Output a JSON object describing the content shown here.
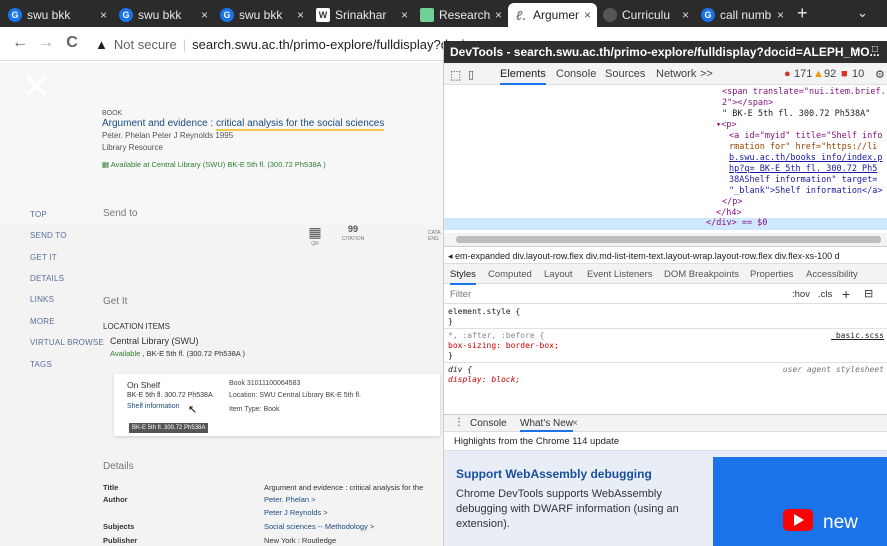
{
  "browser": {
    "tabs": [
      {
        "title": "swu bkk",
        "icon": "chrome-icon",
        "close": "×"
      },
      {
        "title": "swu bkk",
        "icon": "chrome-icon",
        "close": "×"
      },
      {
        "title": "swu bkk",
        "icon": "chrome-icon",
        "close": "×"
      },
      {
        "title": "Srinakhar",
        "icon": "wikipedia-icon",
        "close": "×"
      },
      {
        "title": "Research",
        "icon": "research-icon",
        "close": "×"
      },
      {
        "title": "Argumen",
        "icon": "document-icon",
        "close": "×"
      },
      {
        "title": "Curriculu",
        "icon": "loading-icon",
        "close": "×"
      },
      {
        "title": "call numb",
        "icon": "chrome-icon",
        "close": "×"
      }
    ],
    "new_tab": "+",
    "tab_menu": "⌄",
    "back": "←",
    "forward": "→",
    "reload": "C",
    "security": "Not secure",
    "url": "search.swu.ac.th/primo-explore/fulldisplay?docid=ALEPH"
  },
  "page": {
    "item_type": "BOOK",
    "title_main": "Argument and evidence : ",
    "title_highlight": "critical analysis for the social sciences",
    "authors": "Peter. Phelan Peter J Reynolds 1995",
    "resource": "Library Resource",
    "availability": "Available at Central Library (SWU)  BK-E 5th fl. (300.72 Ph538A )",
    "nav": [
      "TOP",
      "SEND TO",
      "GET IT",
      "DETAILS",
      "LINKS",
      "MORE",
      "VIRTUAL BROWSE",
      "TAGS"
    ],
    "send_to_heading": "Send to",
    "send_options": [
      {
        "icon": "qr-icon",
        "glyph": "▦",
        "label": "QR"
      },
      {
        "icon": "citation-icon",
        "glyph": "99",
        "label": "CITATION"
      },
      {
        "icon": "catalog-icon",
        "glyph": "",
        "label": "CATA ENG"
      }
    ],
    "get_it_heading": "Get It",
    "location_items": "LOCATION ITEMS",
    "library": "Central Library (SWU)",
    "library_status": "Available",
    "library_shelf": " , BK-E 5th fl. (300.72 Ph538A )",
    "card": {
      "status": "On Shelf",
      "call_no": "BK-E 5th fl. 300.72 Ph538A",
      "shelf_link": "Shelf information",
      "barcode": "Book 31011100064583",
      "location": "Location: SWU Central Library BK-E 5th fl.",
      "item_type": "Item Type: Book",
      "tooltip": "BK-E 5th fl. 300.72 Ph538A"
    },
    "details_heading": "Details",
    "details": [
      {
        "label": "Title",
        "values": [
          "Argument and evidence : critical analysis for the"
        ]
      },
      {
        "label": "Author",
        "values": [
          "Peter. Phelan >",
          "Peter J Reynolds >"
        ]
      },
      {
        "label": "Subjects",
        "values": [
          "Social sciences -- Methodology >"
        ]
      },
      {
        "label": "Publisher",
        "values": [
          "New York : Routledge"
        ]
      }
    ]
  },
  "devtools": {
    "title": "DevTools - search.swu.ac.th/primo-explore/fulldisplay?docid=ALEPH_MO...",
    "window_controls": [
      "–",
      "□"
    ],
    "tabs": [
      "Elements",
      "Console",
      "Sources",
      "Network",
      ">>"
    ],
    "errors": "171",
    "warnings": "92",
    "issues": "10",
    "code": [
      "<span translate=\"nui.item.brief.",
      "2\"></span>",
      "\" BK-E 5th fl. 300.72 Ph538A\"",
      "▾<p>",
      "<a id=\"myid\" title=\"Shelf info",
      "rmation for\" href=\"https://li",
      "b.swu.ac.th/books_info/index.p",
      "hp?q= BK-E  5th fl. 300.72 Ph5",
      "38AShelf information\" target=",
      "\"_blank\">Shelf information</a>",
      "</p>",
      "</h4>",
      "</div> == $0"
    ],
    "breadcrumbs": "◂ em-expanded  div.layout-row.flex  div.md-list-item-text.layout-wrap.layout-row.flex  div.flex-xs-100  d",
    "style_tabs": [
      "Styles",
      "Computed",
      "Layout",
      "Event Listeners",
      "DOM Breakpoints",
      "Properties",
      "Accessibility"
    ],
    "filter_placeholder": "Filter",
    "filter_tools": [
      ":hov",
      ".cls",
      "+"
    ],
    "rules": [
      {
        "sel": "element.style {",
        "src": ""
      },
      {
        "sel": "}",
        "src": ""
      },
      {
        "sel": "*, :after, :before {",
        "src": "_basic.scss"
      },
      {
        "sel": "  box-sizing: border-box;",
        "src": ""
      },
      {
        "sel": "}",
        "src": ""
      },
      {
        "sel": "div {",
        "src": "user agent stylesheet"
      },
      {
        "sel": "  display: block;",
        "src": ""
      }
    ],
    "drawer_tabs": [
      "Console",
      "What's New"
    ],
    "drawer_close": "×",
    "highlights": "Highlights from the Chrome 114 update",
    "news_title": "Support WebAssembly debugging",
    "news_body": "Chrome DevTools supports WebAssembly debugging with DWARF information (using an extension).",
    "news_badge": "new"
  }
}
